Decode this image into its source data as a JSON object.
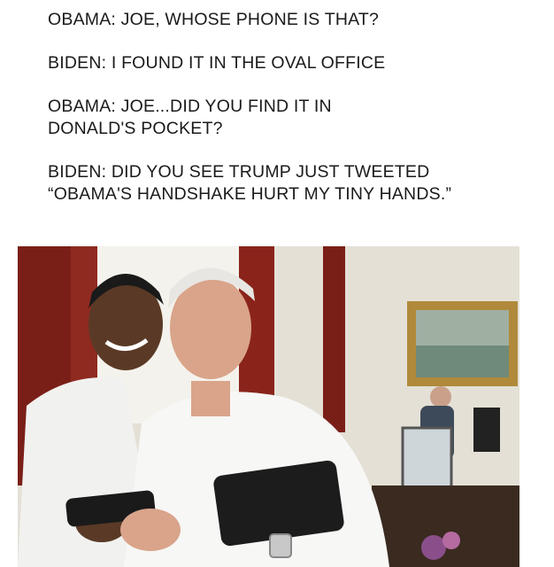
{
  "dialogue": [
    {
      "lines": [
        "OBAMA: JOE, WHOSE PHONE IS THAT?"
      ]
    },
    {
      "lines": [
        "BIDEN: I FOUND IT IN THE OVAL OFFICE"
      ]
    },
    {
      "lines": [
        "OBAMA: JOE...DID YOU FIND IT IN",
        "DONALD'S POCKET?"
      ]
    },
    {
      "lines": [
        "BIDEN: DID YOU SEE TRUMP JUST TWEETED",
        "“OBAMA'S HANDSHAKE HURT MY TINY HANDS.”"
      ]
    }
  ],
  "photo": {
    "colors": {
      "curtain": "#7a1f18",
      "wall": "#e4e0d6",
      "window": "#f4f2ec",
      "frame": "#b08a3a",
      "shirt": "#f7f7f5",
      "skin_dark": "#5a3a26",
      "skin_light": "#d9a48a",
      "hair_white": "#e8e6e2",
      "folder": "#1c1c1c"
    }
  }
}
